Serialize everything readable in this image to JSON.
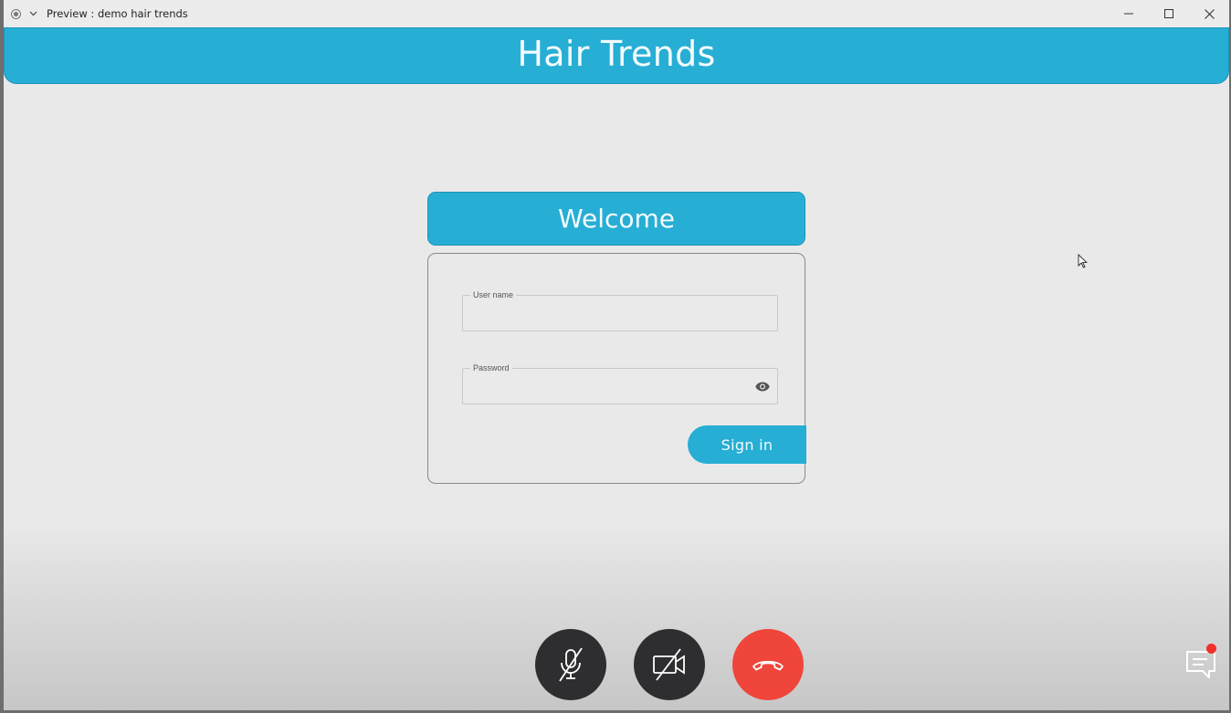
{
  "window": {
    "title": "Preview : demo hair trends"
  },
  "app": {
    "title": "Hair Trends"
  },
  "login": {
    "banner": "Welcome",
    "username_label": "User name",
    "username_value": "",
    "password_label": "Password",
    "password_value": "",
    "signin_label": "Sign in"
  },
  "call_controls": {
    "mic_icon": "mic-off-icon",
    "camera_icon": "camera-off-icon",
    "hangup_icon": "phone-hangup-icon",
    "chat_icon": "chat-icon",
    "chat_has_notification": true
  },
  "colors": {
    "accent": "#27aed4",
    "hangup": "#f0453a",
    "control_dark": "#2e2e30",
    "notification": "#f0302a"
  }
}
